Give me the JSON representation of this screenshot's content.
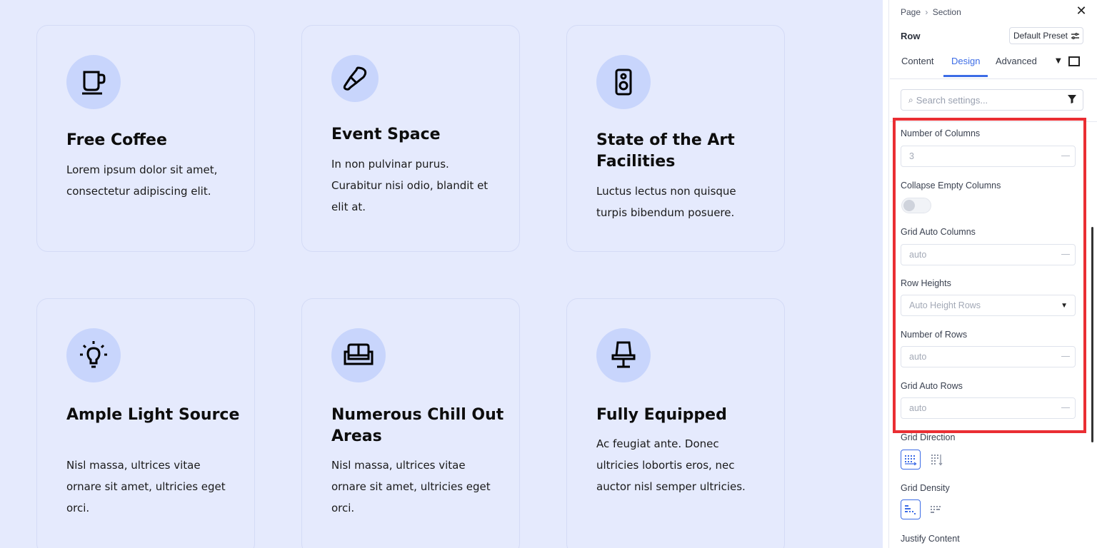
{
  "cards": [
    {
      "title": "Free Coffee",
      "body": "Lorem ipsum dolor sit amet, consectetur adipiscing elit.",
      "icon": "coffee-cup-icon"
    },
    {
      "title": "Event Space",
      "body": "In non pulvinar purus. Curabitur nisi odio, blandit et elit at.",
      "icon": "microphone-icon"
    },
    {
      "title": "State of the Art Facilities",
      "body": "Luctus lectus non quisque turpis bibendum posuere.",
      "icon": "speaker-icon"
    },
    {
      "title": "Ample Light Source",
      "body": "Nisl massa, ultrices vitae ornare sit amet, ultricies eget orci.",
      "icon": "lightbulb-icon"
    },
    {
      "title": "Numerous Chill Out Areas",
      "body": "Nisl massa, ultrices vitae ornare sit amet, ultricies eget orci.",
      "icon": "sofa-icon"
    },
    {
      "title": "Fully Equipped",
      "body": "Ac feugiat ante. Donec ultricies lobortis eros, nec auctor nisl semper ultricies.",
      "icon": "desk-lamp-icon"
    }
  ],
  "panel": {
    "breadcrumb": {
      "page": "Page",
      "separator": "›",
      "section": "Section"
    },
    "title": "Row",
    "preset": "Default Preset",
    "tabs": [
      "Content",
      "Design",
      "Advanced"
    ],
    "active_tab": "Design",
    "search_placeholder": "Search settings...",
    "settings": {
      "number_of_columns": {
        "label": "Number of Columns",
        "value": "3"
      },
      "collapse_empty_columns": {
        "label": "Collapse Empty Columns",
        "enabled": false
      },
      "grid_auto_columns": {
        "label": "Grid Auto Columns",
        "value": "auto"
      },
      "row_heights": {
        "label": "Row Heights",
        "value": "Auto Height Rows"
      },
      "number_of_rows": {
        "label": "Number of Rows",
        "value": "auto"
      },
      "grid_auto_rows": {
        "label": "Grid Auto Rows",
        "value": "auto"
      },
      "grid_direction": {
        "label": "Grid Direction"
      },
      "grid_density": {
        "label": "Grid Density"
      },
      "justify_content": {
        "label": "Justify Content"
      }
    }
  },
  "colors": {
    "canvas_bg": "#e5eafd",
    "icon_circle": "#c8d5fc",
    "accent": "#3c6ce6",
    "highlight_border": "#ea2e33"
  }
}
